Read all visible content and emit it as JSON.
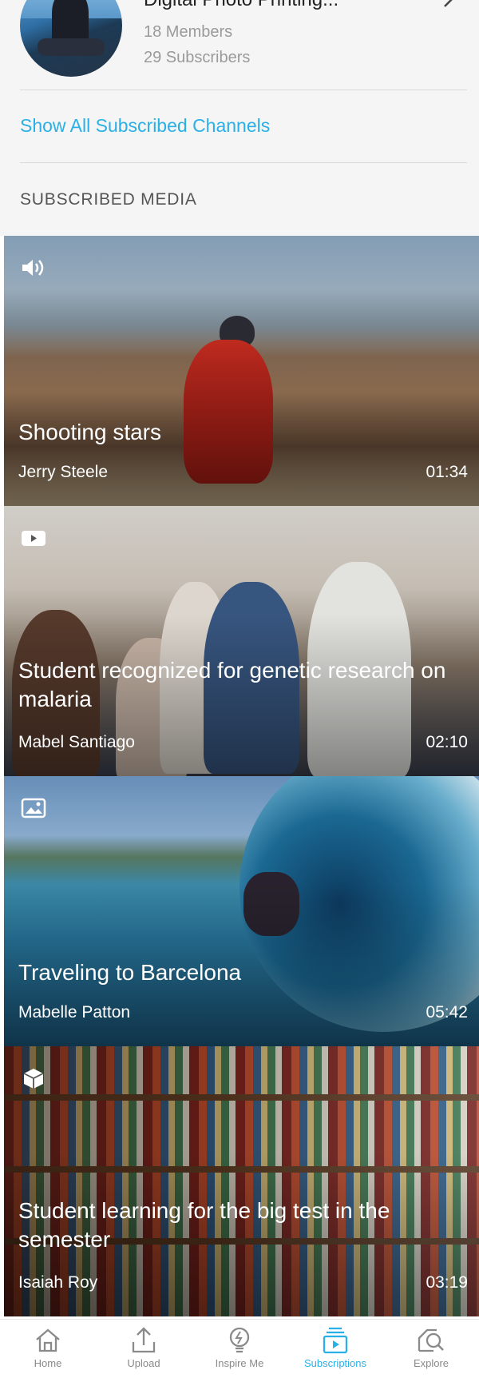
{
  "channel": {
    "name": "Digital Photo Printing...",
    "members": "18 Members",
    "subscribers": "29 Subscribers"
  },
  "show_all_label": "Show All Subscribed Channels",
  "section_title": "SUBSCRIBED MEDIA",
  "media": [
    {
      "type_icon": "audio-icon",
      "title": "Shooting stars",
      "author": "Jerry Steele",
      "duration": "01:34"
    },
    {
      "type_icon": "video-icon",
      "title": "Student recognized for genetic research on malaria",
      "author": "Mabel Santiago",
      "duration": "02:10"
    },
    {
      "type_icon": "image-icon",
      "title": "Traveling to Barcelona",
      "author": "Mabelle Patton",
      "duration": "05:42"
    },
    {
      "type_icon": "3d-box-icon",
      "title": "Student learning for the big test in the semester",
      "author": "Isaiah Roy",
      "duration": "03:19"
    }
  ],
  "nav": {
    "items": [
      {
        "label": "Home",
        "icon": "home-icon"
      },
      {
        "label": "Upload",
        "icon": "upload-icon"
      },
      {
        "label": "Inspire Me",
        "icon": "bulb-icon"
      },
      {
        "label": "Subscriptions",
        "icon": "subscriptions-icon",
        "active": true
      },
      {
        "label": "Explore",
        "icon": "explore-icon"
      }
    ]
  },
  "colors": {
    "accent": "#2ab0e6",
    "nav_inactive": "#8a8a8a",
    "background": "#f5f5f5"
  }
}
